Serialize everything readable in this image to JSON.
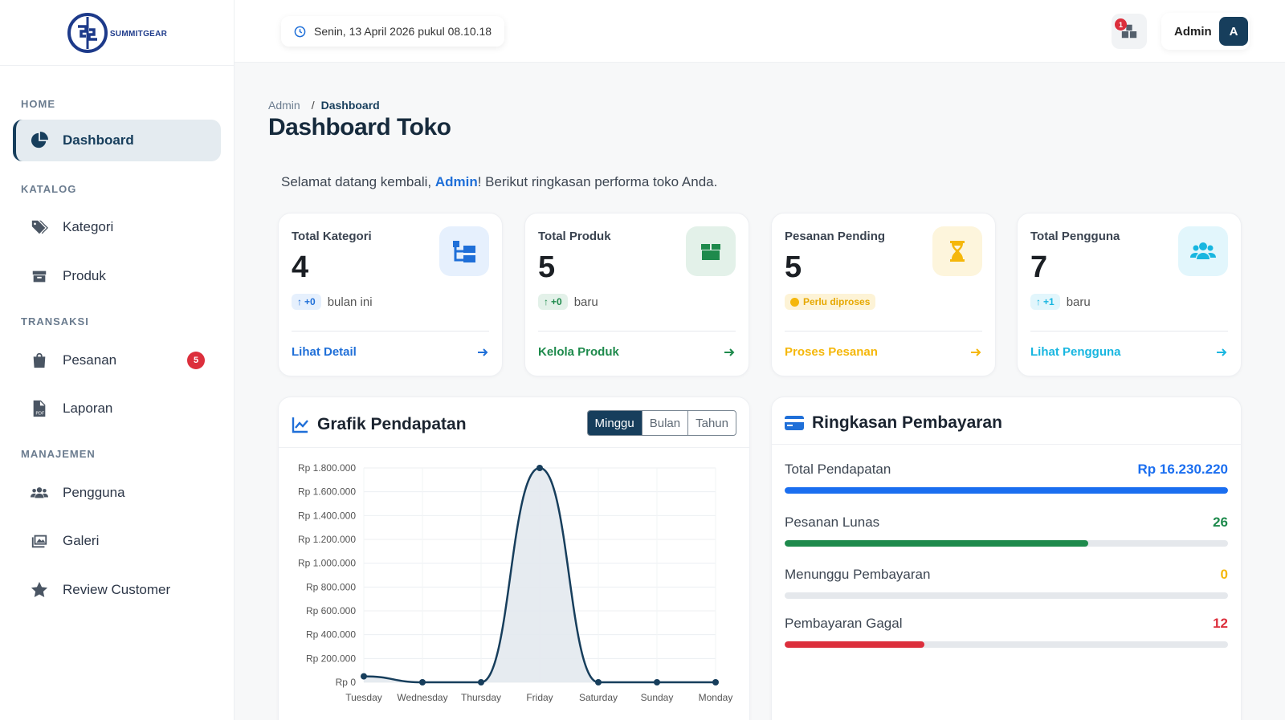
{
  "brand": {
    "name": "SUMMITGEAR"
  },
  "sidebar": {
    "sections": [
      "HOME",
      "KATALOG",
      "TRANSAKSI",
      "MANAJEMEN"
    ],
    "items": [
      {
        "label": "Dashboard",
        "icon": "pie-chart-icon"
      },
      {
        "label": "Kategori",
        "icon": "tags-icon"
      },
      {
        "label": "Produk",
        "icon": "box-icon"
      },
      {
        "label": "Pesanan",
        "icon": "shopping-bag-icon",
        "badge": "5"
      },
      {
        "label": "Laporan",
        "icon": "pdf-file-icon"
      },
      {
        "label": "Pengguna",
        "icon": "users-icon"
      },
      {
        "label": "Galeri",
        "icon": "images-icon"
      },
      {
        "label": "Review Customer",
        "icon": "star-icon"
      }
    ]
  },
  "topbar": {
    "datetime": "Senin, 13 April 2026 pukul 08.10.18",
    "notification_count": "1",
    "user_name": "Admin",
    "avatar_initial": "A"
  },
  "breadcrumb": {
    "root": "Admin",
    "sep": "/",
    "current": "Dashboard"
  },
  "page": {
    "title": "Dashboard Toko",
    "welcome_prefix": "Selamat datang kembali, ",
    "welcome_name": "Admin",
    "welcome_suffix": "! Berikut ringkasan performa toko Anda."
  },
  "stats": [
    {
      "label": "Total Kategori",
      "value": "4",
      "delta": "+0",
      "meta": "bulan ini",
      "link": "Lihat Detail",
      "color": "#1f6fd8",
      "icon_bg": "#e6f0fd",
      "icon": "sitemap-icon"
    },
    {
      "label": "Total Produk",
      "value": "5",
      "delta": "+0",
      "meta": "baru",
      "link": "Kelola Produk",
      "color": "#1e8a4c",
      "icon_bg": "#e3f1e9",
      "icon": "box-icon"
    },
    {
      "label": "Pesanan Pending",
      "value": "5",
      "status": "Perlu diproses",
      "link": "Proses Pesanan",
      "color": "#f5b70a",
      "icon_bg": "#fdf5dc",
      "icon": "hourglass-icon"
    },
    {
      "label": "Total Pengguna",
      "value": "7",
      "delta": "+1",
      "meta": "baru",
      "link": "Lihat Pengguna",
      "color": "#18b6e0",
      "icon_bg": "#e2f6fc",
      "icon": "users-icon"
    }
  ],
  "revenue_chart": {
    "title": "Grafik Pendapatan",
    "tabs": [
      "Minggu",
      "Bulan",
      "Tahun"
    ],
    "active_tab": "Minggu"
  },
  "chart_data": {
    "type": "area",
    "x": [
      "Tuesday",
      "Wednesday",
      "Thursday",
      "Friday",
      "Saturday",
      "Sunday",
      "Monday"
    ],
    "series": [
      {
        "values": [
          50000,
          0,
          0,
          1800000,
          0,
          0,
          0
        ]
      }
    ],
    "yticks": [
      "Rp 0",
      "Rp 200.000",
      "Rp 400.000",
      "Rp 600.000",
      "Rp 800.000",
      "Rp 1.000.000",
      "Rp 1.200.000",
      "Rp 1.400.000",
      "Rp 1.600.000",
      "Rp 1.800.000"
    ],
    "ylim": [
      0,
      1800000
    ],
    "grid": true,
    "colors": {
      "line": "#173e5c",
      "fill": "#e3e9ee"
    }
  },
  "payment_summary": {
    "title": "Ringkasan Pembayaran",
    "rows": [
      {
        "label": "Total Pendapatan",
        "value": "Rp 16.230.220",
        "fraction": 1.0,
        "color": "#1a6ef0"
      },
      {
        "label": "Pesanan Lunas",
        "value": "26",
        "fraction": 0.685,
        "color": "#1e8a4c"
      },
      {
        "label": "Menunggu Pembayaran",
        "value": "0",
        "fraction": 0.0,
        "color": "#f5b70a"
      },
      {
        "label": "Pembayaran Gagal",
        "value": "12",
        "fraction": 0.316,
        "color": "#dc2f3c"
      }
    ]
  }
}
